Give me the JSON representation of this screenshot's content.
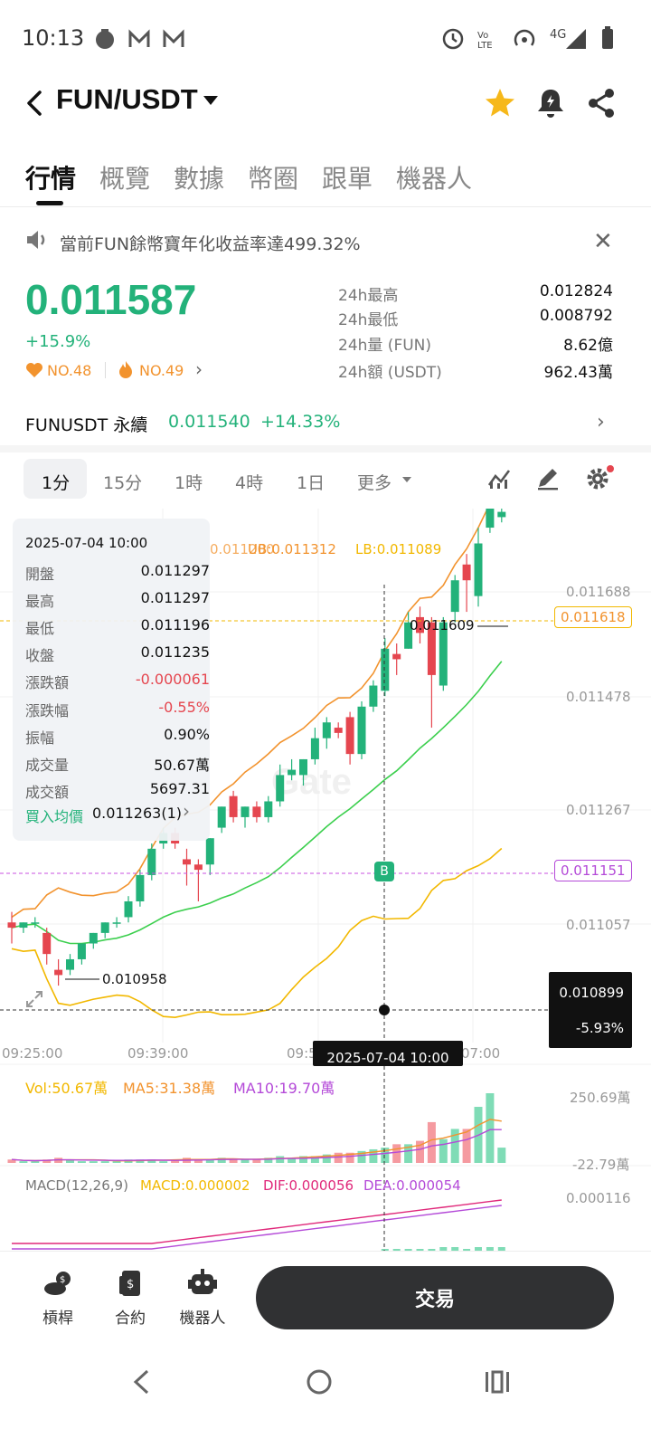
{
  "status": {
    "time": "10:13",
    "network": "4G"
  },
  "header": {
    "pair": "FUN/USDT"
  },
  "tabs": [
    {
      "label": "行情",
      "active": true
    },
    {
      "label": "概覽"
    },
    {
      "label": "數據"
    },
    {
      "label": "幣圈"
    },
    {
      "label": "跟單"
    },
    {
      "label": "機器人"
    }
  ],
  "notice": {
    "text": "當前FUN餘幣寶年化收益率達499.32%"
  },
  "ticker": {
    "price": "0.011587",
    "change": "+15.9%",
    "rank1": "NO.48",
    "rank2": "NO.49",
    "stats": [
      {
        "label": "24h最高",
        "value": "0.012824"
      },
      {
        "label": "24h最低",
        "value": "0.008792"
      },
      {
        "label": "24h量 (FUN)",
        "value": "8.62億"
      },
      {
        "label": "24h額 (USDT)",
        "value": "962.43萬"
      }
    ]
  },
  "perp": {
    "label": "FUNUSDT 永續",
    "price": "0.011540",
    "change": "+14.33%"
  },
  "intervals": [
    {
      "label": "1分",
      "active": true
    },
    {
      "label": "15分"
    },
    {
      "label": "1時"
    },
    {
      "label": "4時"
    },
    {
      "label": "1日"
    },
    {
      "label": "更多"
    }
  ],
  "ohlc": {
    "date": "2025-07-04 10:00",
    "rows": [
      {
        "label": "開盤",
        "value": "0.011297"
      },
      {
        "label": "最高",
        "value": "0.011297"
      },
      {
        "label": "最低",
        "value": "0.011196"
      },
      {
        "label": "收盤",
        "value": "0.011235"
      },
      {
        "label": "漲跌額",
        "value": "-0.000061"
      },
      {
        "label": "漲跌幅",
        "value": "-0.55%"
      },
      {
        "label": "振幅",
        "value": "0.90%"
      },
      {
        "label": "成交量",
        "value": "50.67萬"
      },
      {
        "label": "成交額",
        "value": "5697.31"
      }
    ],
    "avg_buy_label": "買入均價",
    "avg_buy_value": "0.011263(1)"
  },
  "boll_legend": {
    "mb_partial": "0.011200",
    "ub": "UB:0.011312",
    "lb": "LB:0.011089"
  },
  "y_axis": [
    "0.011688",
    "0.011478",
    "0.011267",
    "0.011057"
  ],
  "current_price_tag": "0.011618",
  "avg_price_tag": "0.011151",
  "crosshair": {
    "price": "0.010899",
    "change": "-5.93%",
    "time": "2025-07-04 10:00"
  },
  "x_axis": [
    "09:25:00",
    "09:39:00",
    "09:5",
    "07:00"
  ],
  "high_marker": "0.011609",
  "low_marker": "0.010958",
  "vol_legend": {
    "vol": "Vol:50.67萬",
    "ma5": "MA5:31.38萬",
    "ma10": "MA10:19.70萬"
  },
  "vol_axis": [
    "250.69萬",
    "-22.79萬"
  ],
  "macd_legend": {
    "name": "MACD(12,26,9)",
    "macd": "MACD:0.000002",
    "dif": "DIF:0.000056",
    "dea": "DEA:0.000054"
  },
  "macd_axis": "0.000116",
  "watermark": "Gate",
  "buy_marker": "B",
  "bottom_nav": [
    {
      "label": "槓桿"
    },
    {
      "label": "合約"
    },
    {
      "label": "機器人"
    }
  ],
  "trade_label": "交易",
  "colors": {
    "up": "#23b27a",
    "down": "#e5464f",
    "accent": "#f2932e",
    "star": "#f6b81a"
  },
  "candles": [
    [
      0.01106,
      0.01108,
      0.01102,
      0.01105
    ],
    [
      0.01105,
      0.01106,
      0.01104,
      0.01106
    ],
    [
      0.01106,
      0.01107,
      0.01105,
      0.01106
    ],
    [
      0.01104,
      0.01105,
      0.01098,
      0.011
    ],
    [
      0.01097,
      0.01099,
      0.01094,
      0.01096
    ],
    [
      0.01097,
      0.011,
      0.01096,
      0.01099
    ],
    [
      0.01099,
      0.01102,
      0.01098,
      0.01102
    ],
    [
      0.01102,
      0.01104,
      0.01101,
      0.01104
    ],
    [
      0.01104,
      0.01106,
      0.01103,
      0.01106
    ],
    [
      0.01106,
      0.01107,
      0.01105,
      0.01106
    ],
    [
      0.01107,
      0.01111,
      0.01106,
      0.0111
    ],
    [
      0.0111,
      0.01116,
      0.01109,
      0.01115
    ],
    [
      0.01115,
      0.01121,
      0.01114,
      0.0112
    ],
    [
      0.01121,
      0.01124,
      0.0112,
      0.01123
    ],
    [
      0.01123,
      0.01124,
      0.0112,
      0.01121
    ],
    [
      0.01118,
      0.0112,
      0.01113,
      0.01117
    ],
    [
      0.01117,
      0.01118,
      0.0111,
      0.01116
    ],
    [
      0.01117,
      0.01122,
      0.01115,
      0.01122
    ],
    [
      0.01124,
      0.01128,
      0.01123,
      0.01128
    ],
    [
      0.0113,
      0.01131,
      0.01125,
      0.01126
    ],
    [
      0.01126,
      0.01128,
      0.01124,
      0.01128
    ],
    [
      0.01128,
      0.01129,
      0.01125,
      0.01126
    ],
    [
      0.01126,
      0.0113,
      0.01125,
      0.01129
    ],
    [
      0.01129,
      0.01136,
      0.01128,
      0.01134
    ],
    [
      0.01134,
      0.01137,
      0.01133,
      0.01135
    ],
    [
      0.01134,
      0.01137,
      0.01132,
      0.01137
    ],
    [
      0.01137,
      0.01143,
      0.01136,
      0.01141
    ],
    [
      0.01141,
      0.01145,
      0.01139,
      0.01144
    ],
    [
      0.01143,
      0.01144,
      0.01141,
      0.01142
    ],
    [
      0.01145,
      0.01146,
      0.01136,
      0.01138
    ],
    [
      0.01138,
      0.01148,
      0.01137,
      0.01147
    ],
    [
      0.01147,
      0.01152,
      0.01146,
      0.01151
    ],
    [
      0.0115,
      0.0116,
      0.01149,
      0.01158
    ],
    [
      0.01157,
      0.01159,
      0.01153,
      0.01156
    ],
    [
      0.01158,
      0.01165,
      0.01158,
      0.01163
    ],
    [
      0.01164,
      0.01166,
      0.01159,
      0.01161
    ],
    [
      0.01163,
      0.01164,
      0.01143,
      0.01153
    ],
    [
      0.01151,
      0.01164,
      0.0115,
      0.01163
    ],
    [
      0.01165,
      0.01172,
      0.01163,
      0.01171
    ],
    [
      0.01174,
      0.01176,
      0.01165,
      0.01171
    ],
    [
      0.01168,
      0.01181,
      0.01166,
      0.01178
    ],
    [
      0.01181,
      0.01186,
      0.0118,
      0.01185
    ],
    [
      0.01183,
      0.01185,
      0.01182,
      0.01184
    ]
  ],
  "volumes": [
    2,
    1,
    1,
    2,
    3,
    2,
    1,
    1,
    1,
    1,
    2,
    2,
    2,
    1,
    2,
    3,
    2,
    2,
    3,
    2,
    2,
    2,
    3,
    4,
    3,
    4,
    4,
    5,
    6,
    6,
    7,
    8,
    9,
    11,
    11,
    13,
    24,
    14,
    20,
    20,
    33,
    41,
    9
  ],
  "macd_hist": [
    0,
    0,
    0,
    0,
    0,
    0,
    0,
    0,
    0,
    0,
    0,
    0,
    0,
    0,
    0,
    0,
    0,
    0,
    0,
    0,
    0,
    0,
    0,
    0,
    0,
    0,
    0,
    0,
    0,
    0,
    0,
    0,
    1,
    1,
    1,
    1,
    1,
    2,
    2,
    1,
    2,
    2,
    2
  ]
}
